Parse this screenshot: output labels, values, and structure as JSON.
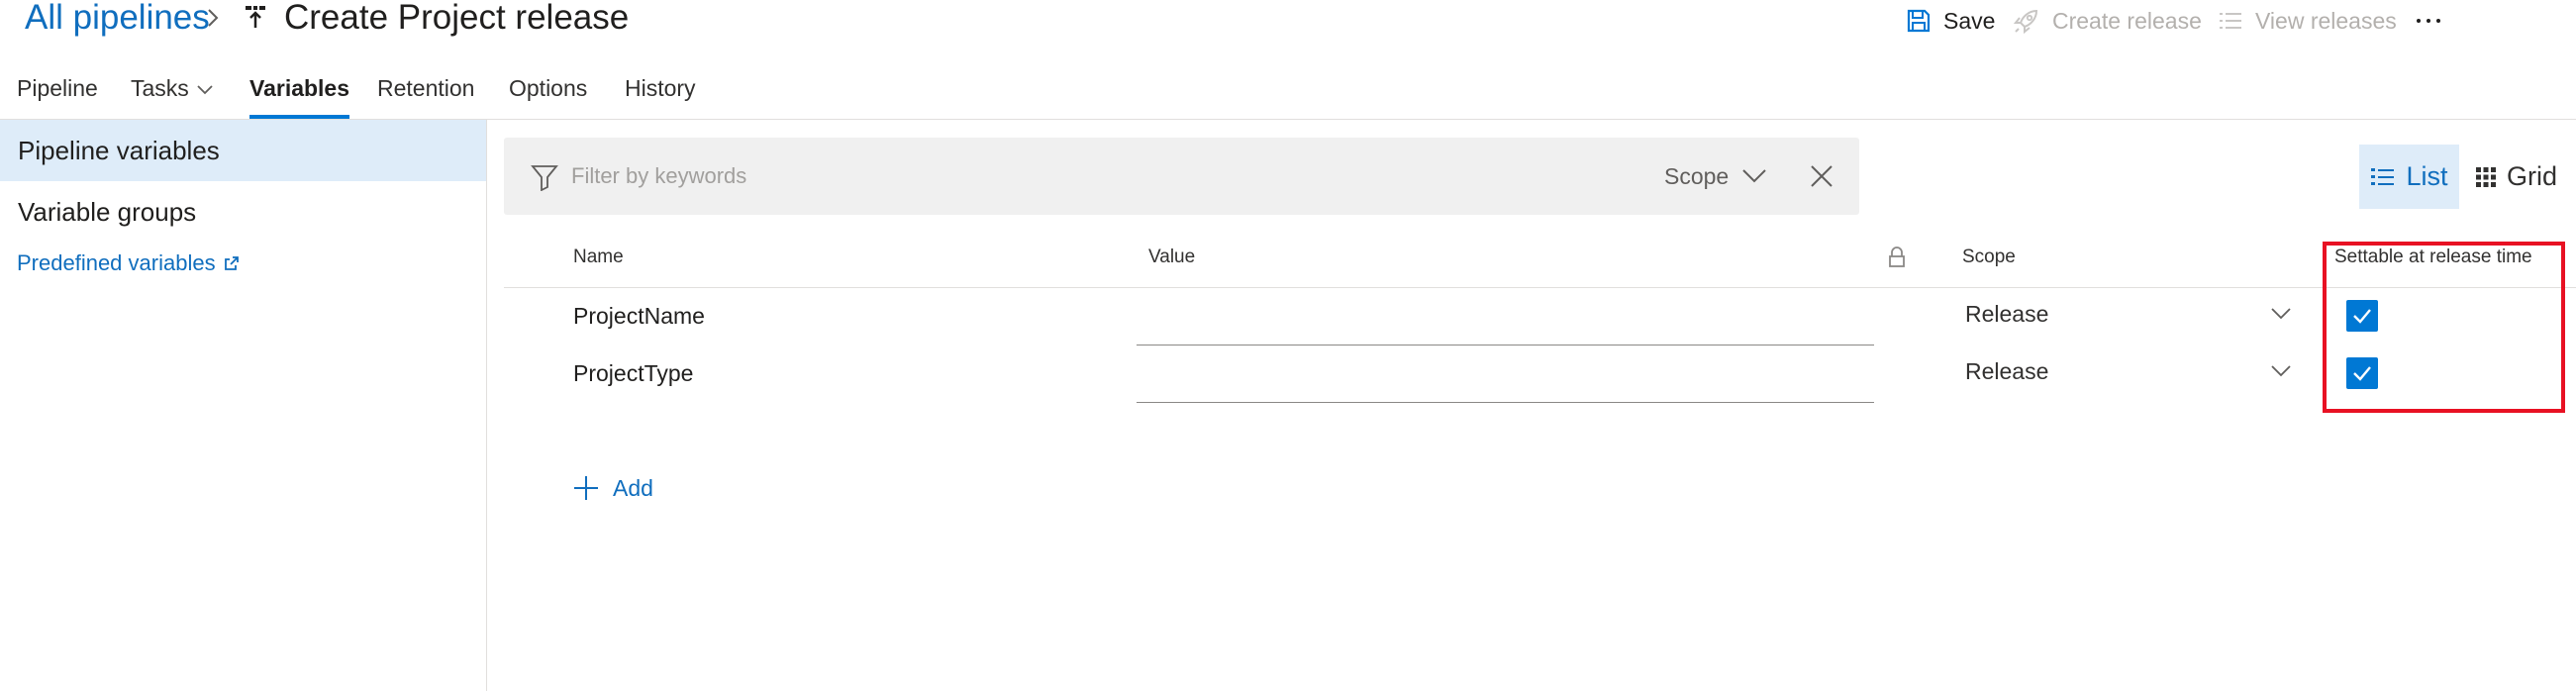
{
  "header": {
    "breadcrumb_root": "All pipelines",
    "title": "Create Project release"
  },
  "toolbar": {
    "save_label": "Save",
    "create_release_label": "Create release",
    "view_releases_label": "View releases"
  },
  "tabs": [
    {
      "label": "Pipeline"
    },
    {
      "label": "Tasks"
    },
    {
      "label": "Variables"
    },
    {
      "label": "Retention"
    },
    {
      "label": "Options"
    },
    {
      "label": "History"
    }
  ],
  "active_tab": "Variables",
  "sidebar": {
    "items": [
      {
        "label": "Pipeline variables"
      },
      {
        "label": "Variable groups"
      }
    ],
    "link_label": "Predefined variables"
  },
  "filter": {
    "placeholder": "Filter by keywords",
    "scope_label": "Scope"
  },
  "view_switch": {
    "list_label": "List",
    "grid_label": "Grid"
  },
  "table": {
    "columns": {
      "name": "Name",
      "value": "Value",
      "scope": "Scope",
      "settable": "Settable at release time"
    },
    "rows": [
      {
        "name": "ProjectName",
        "value": "",
        "scope": "Release",
        "settable": true
      },
      {
        "name": "ProjectType",
        "value": "",
        "scope": "Release",
        "settable": true
      }
    ],
    "add_label": "Add"
  },
  "colors": {
    "accent": "#0078d4",
    "link": "#106ebe",
    "selection_bg": "#deecf9",
    "highlight_border": "#e81123",
    "disabled_text": "#b3b0ad"
  },
  "icons": {
    "save": "save-icon",
    "create_release": "rocket-icon",
    "view_releases": "list-icon",
    "more": "more-icon",
    "filter": "filter-icon",
    "clear": "close-icon",
    "lock": "lock-icon",
    "add": "plus-icon"
  }
}
